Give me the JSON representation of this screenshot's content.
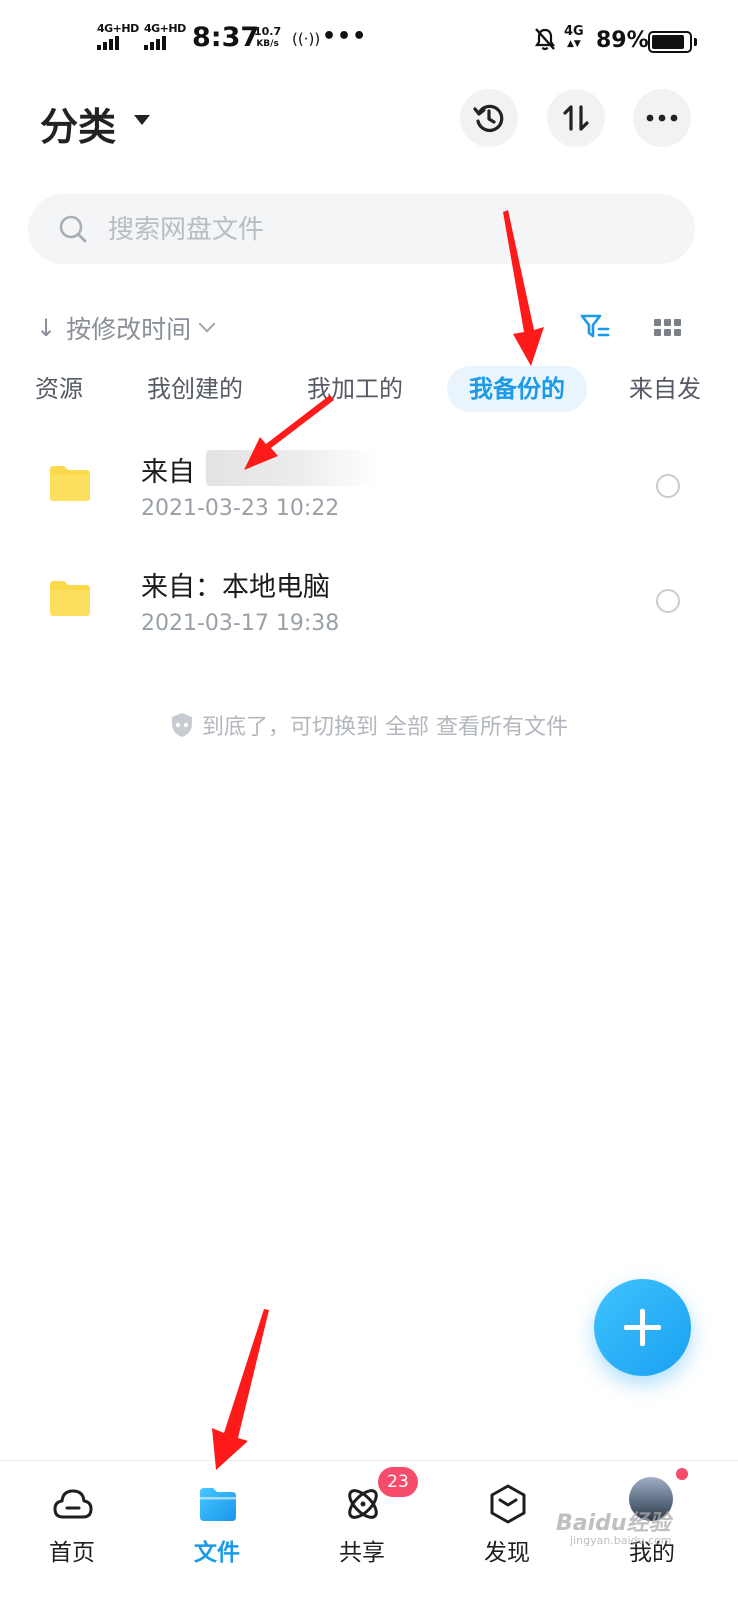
{
  "status_bar": {
    "sim1": "4G+HD",
    "sim2": "4G+HD",
    "time": "8:37",
    "speed_value": "10.7",
    "speed_unit": "KB/s",
    "hotspot": "((·))",
    "more": "•••",
    "lte": "4G",
    "battery": "89%",
    "battery_level": 0.89
  },
  "header": {
    "title": "分类",
    "icons": [
      "history-icon",
      "transfer-icon",
      "more-icon"
    ]
  },
  "search": {
    "placeholder": "搜索网盘文件"
  },
  "sort": {
    "arrow": "↓",
    "label": "按修改时间"
  },
  "tabs": [
    {
      "label": "资源",
      "active": false
    },
    {
      "label": "我创建的",
      "active": false
    },
    {
      "label": "我加工的",
      "active": false
    },
    {
      "label": "我备份的",
      "active": true
    },
    {
      "label": "来自发",
      "active": false
    }
  ],
  "files": [
    {
      "name": "来自",
      "date": "2021-03-23  10:22"
    },
    {
      "name": "来自：本地电脑",
      "date": "2021-03-17  19:38"
    }
  ],
  "end_tip": "到底了，可切换到 全部 查看所有文件",
  "bottom_nav": [
    {
      "label": "首页",
      "icon": "cloud-icon",
      "active": false
    },
    {
      "label": "文件",
      "icon": "folder-icon",
      "active": true
    },
    {
      "label": "共享",
      "icon": "orbit-icon",
      "active": false,
      "badge": "23"
    },
    {
      "label": "发现",
      "icon": "cube-icon",
      "active": false
    },
    {
      "label": "我的",
      "icon": "avatar",
      "active": false
    }
  ],
  "watermark": {
    "main": "Baidu经验",
    "sub": "jingyan.baidu.com"
  },
  "colors": {
    "accent": "#1a9ae8",
    "folder": "#fcd84b",
    "badge": "#f64b6a",
    "annotation_arrow": "#ff1a1a"
  }
}
